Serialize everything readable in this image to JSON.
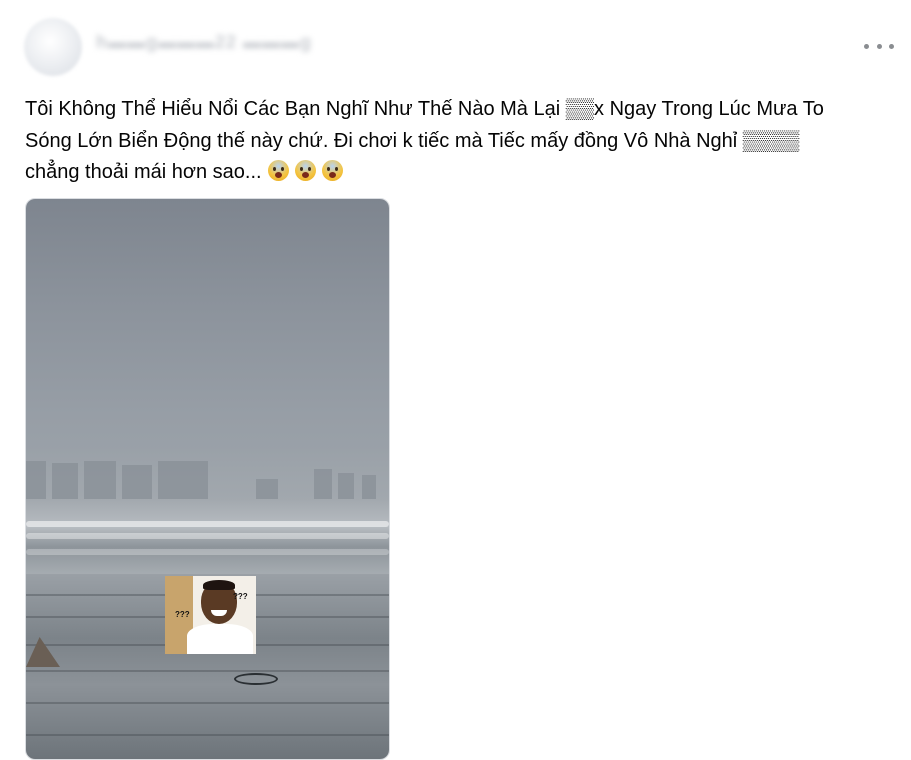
{
  "post": {
    "author_name": "h▬▬g▬▬▬22 ▬▬▬g",
    "text_lines": [
      "Tôi Không Thể Hiểu Nổi Các Bạn Nghĩ Như Thế Nào Mà Lại ▒▒x Ngay Trong Lúc Mưa To",
      "Sóng Lớn Biển Động thế này chứ. Đi chơi k tiếc mà Tiếc mấy đồng Vô Nhà Nghỉ ▒▒▒▒",
      "chẳng thoải mái hơn sao..."
    ],
    "emojis": [
      "face-screaming-in-fear",
      "face-screaming-in-fear",
      "face-screaming-in-fear"
    ],
    "media": {
      "type": "video-still",
      "sticker_text_left": "???",
      "sticker_text_right": "???"
    }
  },
  "colors": {
    "text": "#050505",
    "more_dots": "#8a8d91",
    "sky": "#8c939c",
    "beach": "#7c8389"
  }
}
